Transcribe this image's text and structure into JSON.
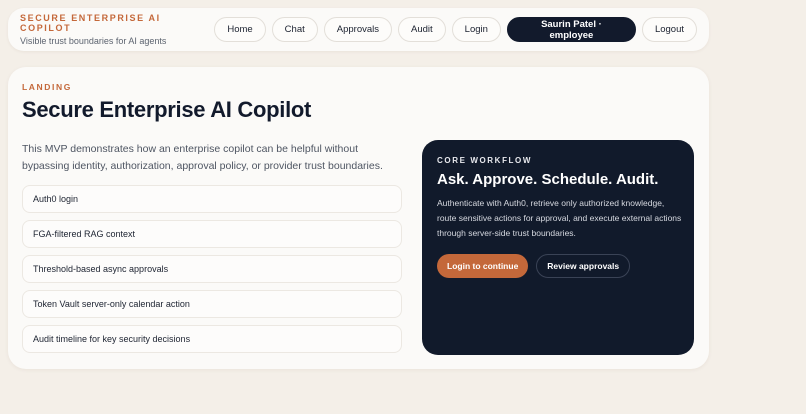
{
  "header": {
    "brand_title": "SECURE ENTERPRISE AI COPILOT",
    "brand_subtitle": "Visible trust boundaries for AI agents",
    "nav": [
      "Home",
      "Chat",
      "Approvals",
      "Audit",
      "Login"
    ],
    "user_label": "Saurin Patel · employee",
    "logout_label": "Logout"
  },
  "main": {
    "kicker": "LANDING",
    "title": "Secure Enterprise AI Copilot",
    "intro": "This MVP demonstrates how an enterprise copilot can be helpful without bypassing identity, authorization, approval policy, or provider trust boundaries.",
    "features": [
      "Auth0 login",
      "FGA-filtered RAG context",
      "Threshold-based async approvals",
      "Token Vault server-only calendar action",
      "Audit timeline for key security decisions"
    ]
  },
  "workflow": {
    "kicker": "CORE WORKFLOW",
    "title": "Ask. Approve. Schedule. Audit.",
    "description": "Authenticate with Auth0, retrieve only authorized knowledge, route sensitive actions for approval, and execute external actions through server-side trust boundaries.",
    "primary_label": "Login to continue",
    "secondary_label": "Review approvals"
  },
  "colors": {
    "accent": "#c4683a",
    "dark_panel": "#111a2b",
    "background": "#f4efe8"
  }
}
